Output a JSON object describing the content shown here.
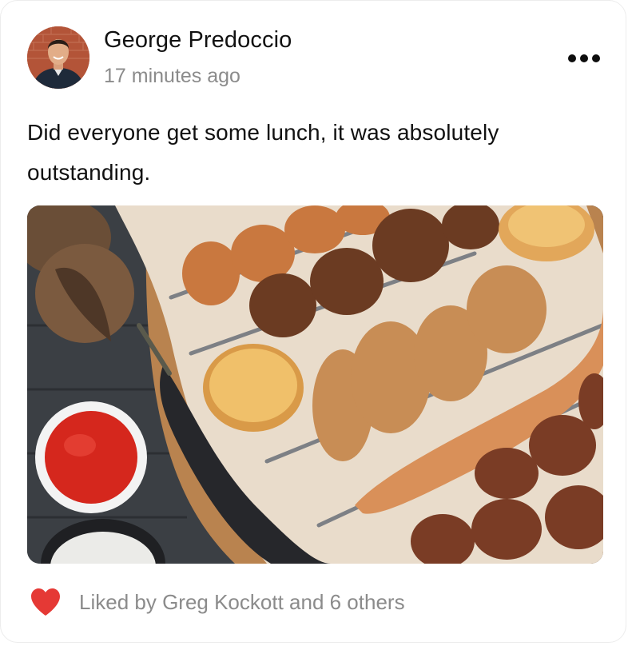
{
  "post": {
    "author": {
      "name": "George Predoccio",
      "avatar_icon": "avatar-photo"
    },
    "timestamp": "17 minutes ago",
    "more_icon": "more-horizontal-icon",
    "text": "Did everyone get some lunch, it was absolutely outstanding.",
    "image": {
      "description_icon": "photo"
    },
    "likes": {
      "text": "Liked by Greg Kockott and 6 others",
      "heart_icon": "heart-icon",
      "heart_color": "#e53935"
    }
  }
}
